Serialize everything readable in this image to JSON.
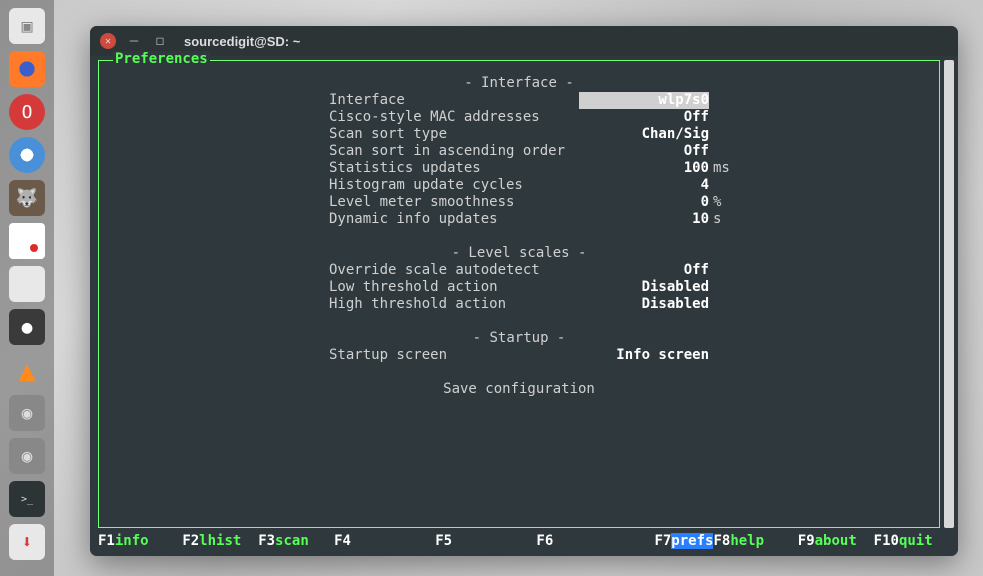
{
  "window": {
    "title": "sourcedigit@SD: ~"
  },
  "frame_title": "Preferences",
  "sections": {
    "interface": {
      "header": "- Interface -",
      "rows": [
        {
          "label": "Interface",
          "value": "wlp7s0",
          "unit": "",
          "selected": true
        },
        {
          "label": "Cisco-style MAC addresses",
          "value": "Off",
          "unit": ""
        },
        {
          "label": "Scan sort type",
          "value": "Chan/Sig",
          "unit": ""
        },
        {
          "label": "Scan sort in ascending order",
          "value": "Off",
          "unit": ""
        },
        {
          "label": "Statistics updates",
          "value": "100",
          "unit": "ms"
        },
        {
          "label": "Histogram update cycles",
          "value": "4",
          "unit": ""
        },
        {
          "label": "Level meter smoothness",
          "value": "0",
          "unit": "%"
        },
        {
          "label": "Dynamic info updates",
          "value": "10",
          "unit": "s"
        }
      ]
    },
    "levels": {
      "header": "- Level scales -",
      "rows": [
        {
          "label": "Override scale autodetect",
          "value": "Off",
          "unit": ""
        },
        {
          "label": "Low threshold action",
          "value": "Disabled",
          "unit": ""
        },
        {
          "label": "High threshold action",
          "value": "Disabled",
          "unit": ""
        }
      ]
    },
    "startup": {
      "header": "- Startup -",
      "rows": [
        {
          "label": "Startup screen",
          "value": "Info screen",
          "unit": ""
        }
      ]
    },
    "save_action": "Save configuration"
  },
  "fkeys": [
    {
      "fn": "F1",
      "label": "info",
      "active": false
    },
    {
      "fn": "F2",
      "label": "lhist",
      "active": false
    },
    {
      "fn": "F3",
      "label": "scan",
      "active": false
    },
    {
      "fn": "F4",
      "label": "",
      "active": false
    },
    {
      "fn": "F5",
      "label": "",
      "active": false
    },
    {
      "fn": "F6",
      "label": "",
      "active": false
    },
    {
      "fn": "F7",
      "label": "prefs",
      "active": true
    },
    {
      "fn": "F8",
      "label": "help",
      "active": false
    },
    {
      "fn": "F9",
      "label": "about",
      "active": false
    },
    {
      "fn": "F10",
      "label": "quit",
      "active": false
    }
  ],
  "dock": {
    "colors": {
      "files": "#e8e8e8",
      "firefox": "#ff7b29",
      "opera": "#d43a3a",
      "chromium": "#4a90d9",
      "lutris": "#6b5a4a",
      "onedrive": "#ffffff",
      "todo": "#ffffff",
      "settings": "#e8e8e8",
      "unknown1": "#3a3a3a",
      "vlc": "#ff8c1a",
      "disk1": "#888",
      "disk2": "#888",
      "terminal": "#2d3436",
      "transmission": "#e8e8e8"
    }
  }
}
